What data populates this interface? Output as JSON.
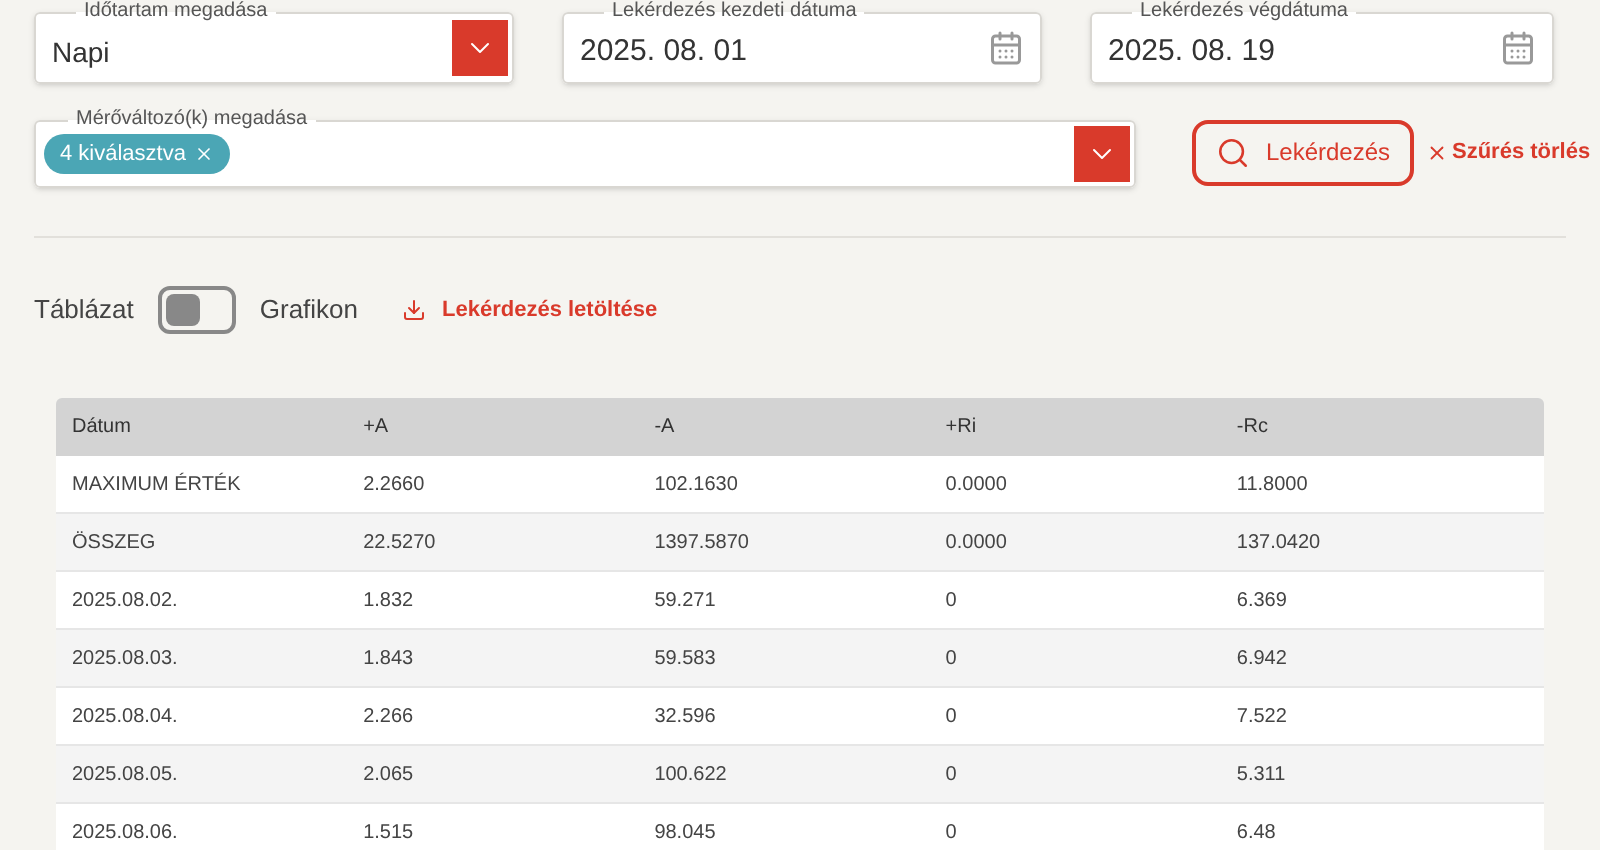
{
  "filters": {
    "period": {
      "label": "Időtartam megadása",
      "value": "Napi"
    },
    "start_date": {
      "label": "Lekérdezés kezdeti dátuma",
      "value": "2025. 08. 01"
    },
    "end_date": {
      "label": "Lekérdezés végdátuma",
      "value": "2025. 08. 19"
    },
    "variables": {
      "label": "Mérőváltozó(k) megadása",
      "chips": [
        "4 kiválasztva"
      ]
    },
    "query_button": "Lekérdezés",
    "clear_link": "Szűrés törlés"
  },
  "view": {
    "left_label": "Táblázat",
    "right_label": "Grafikon",
    "toggle_on": false,
    "download_link": "Lekérdezés letöltése"
  },
  "table": {
    "columns": [
      "Dátum",
      "+A",
      "-A",
      "+Ri",
      "-Rc"
    ],
    "rows": [
      [
        "MAXIMUM ÉRTÉK",
        "2.2660",
        "102.1630",
        "0.0000",
        "11.8000"
      ],
      [
        "ÖSSZEG",
        "22.5270",
        "1397.5870",
        "0.0000",
        "137.0420"
      ],
      [
        "2025.08.02.",
        "1.832",
        "59.271",
        "0",
        "6.369"
      ],
      [
        "2025.08.03.",
        "1.843",
        "59.583",
        "0",
        "6.942"
      ],
      [
        "2025.08.04.",
        "2.266",
        "32.596",
        "0",
        "7.522"
      ],
      [
        "2025.08.05.",
        "2.065",
        "100.622",
        "0",
        "5.311"
      ],
      [
        "2025.08.06.",
        "1.515",
        "98.045",
        "0",
        "6.48"
      ]
    ]
  }
}
